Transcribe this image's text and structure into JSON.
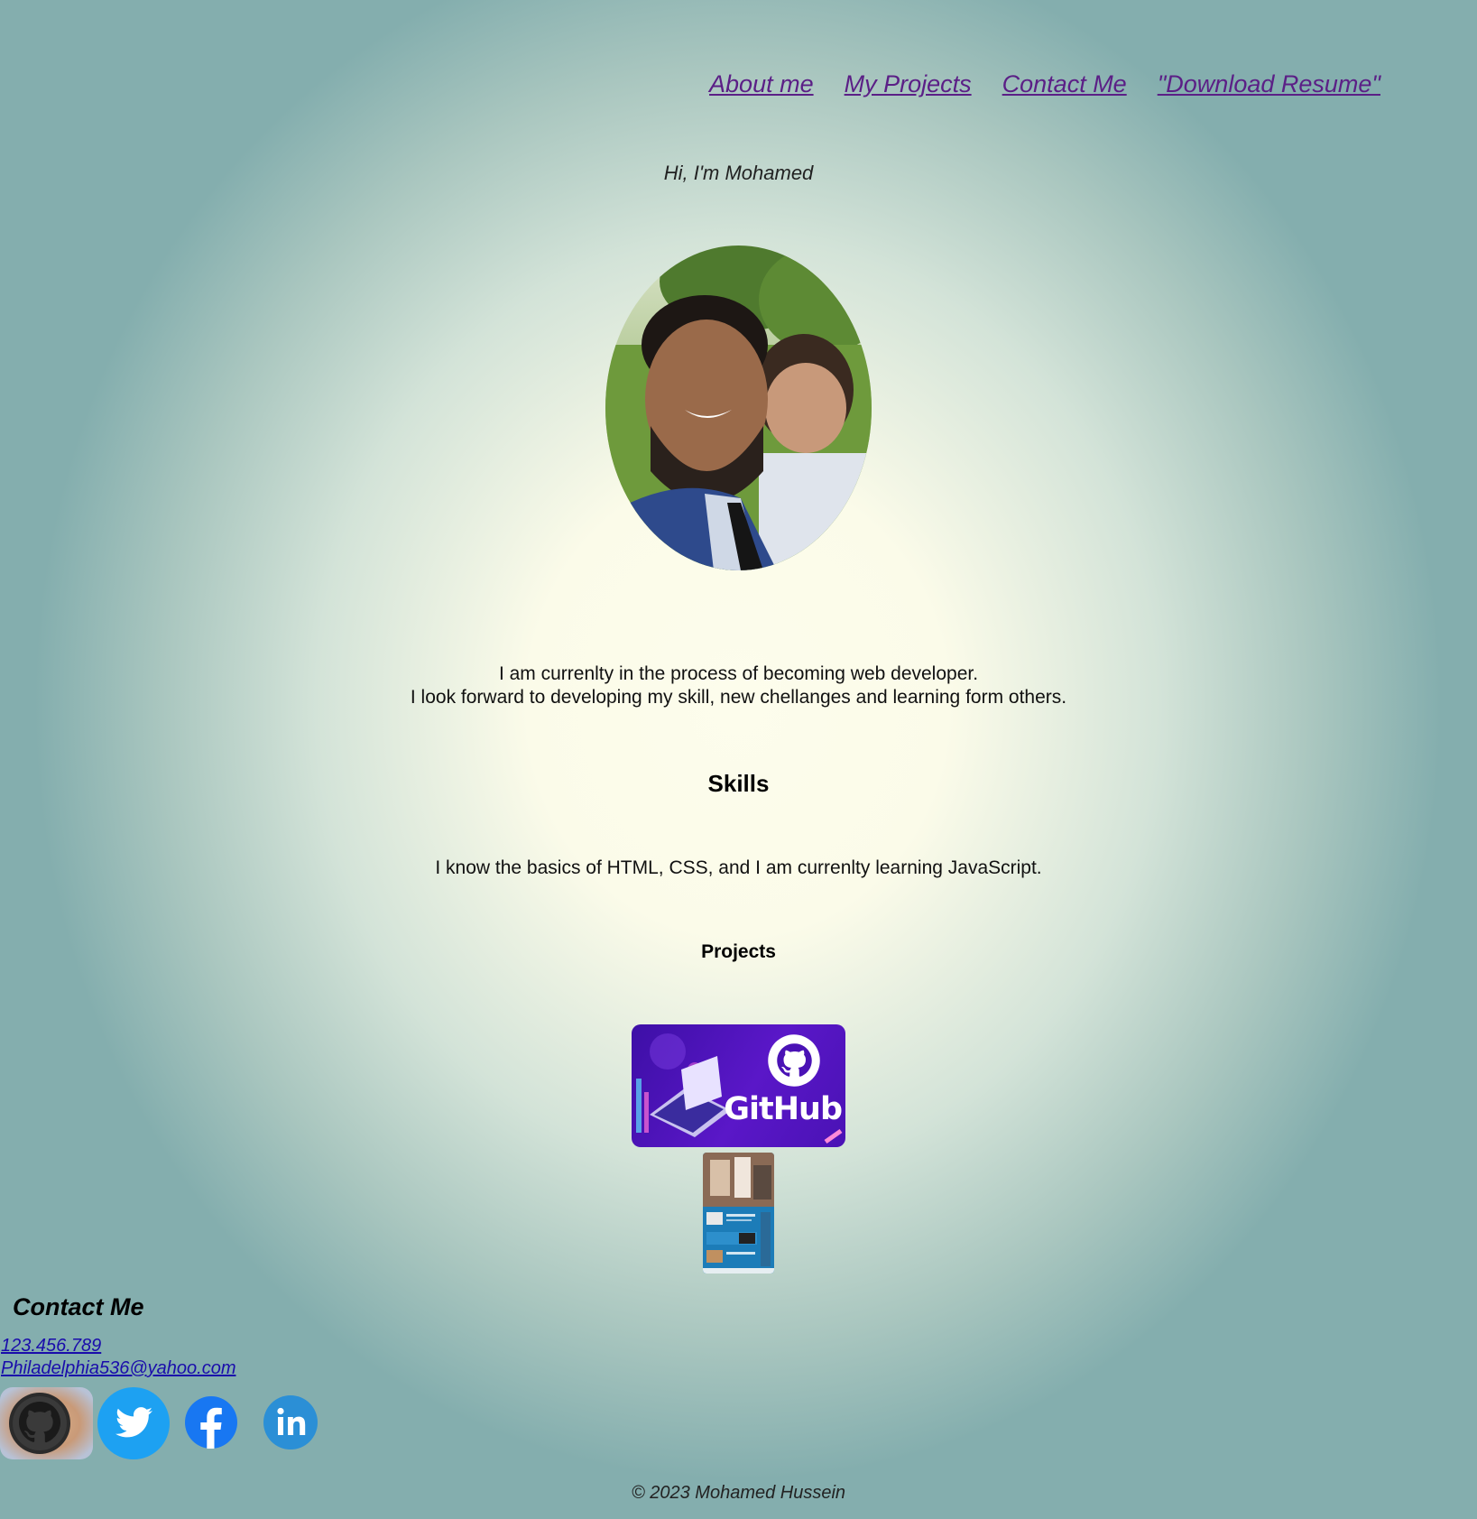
{
  "nav": {
    "items": [
      {
        "label": "About me"
      },
      {
        "label": "My Projects"
      },
      {
        "label": "Contact Me"
      },
      {
        "label": "\"Download Resume\""
      }
    ],
    "link_color": "#5b1f86"
  },
  "hero": {
    "greeting": "Hi, I'm Mohamed",
    "intro_line1": "I am currenlty in the process of becoming web developer.",
    "intro_line2": "I look forward to developing my skill, new chellanges and learning form others."
  },
  "skills": {
    "heading": "Skills",
    "text": "I know the basics of HTML, CSS, and I am currenlty learning JavaScript."
  },
  "projects": {
    "heading": "Projects",
    "items": [
      {
        "logo_text": "GitHub",
        "icon": "github-banner"
      },
      {
        "icon": "website-screenshot"
      }
    ]
  },
  "contact": {
    "heading": "Contact Me",
    "phone": "123.456.789",
    "email": "Philadelphia536@yahoo.com",
    "social": [
      {
        "icon": "github-icon"
      },
      {
        "icon": "twitter-icon",
        "color": "#1da1f2"
      },
      {
        "icon": "facebook-icon",
        "color": "#1877f2"
      },
      {
        "icon": "linkedin-icon",
        "color": "#2b8fd6"
      }
    ]
  },
  "footer": {
    "copyright": "© 2023 Mohamed Hussein"
  },
  "colors": {
    "background_center": "#fdfdec",
    "background_edge": "#84aeae",
    "link": "#1a0dab"
  }
}
